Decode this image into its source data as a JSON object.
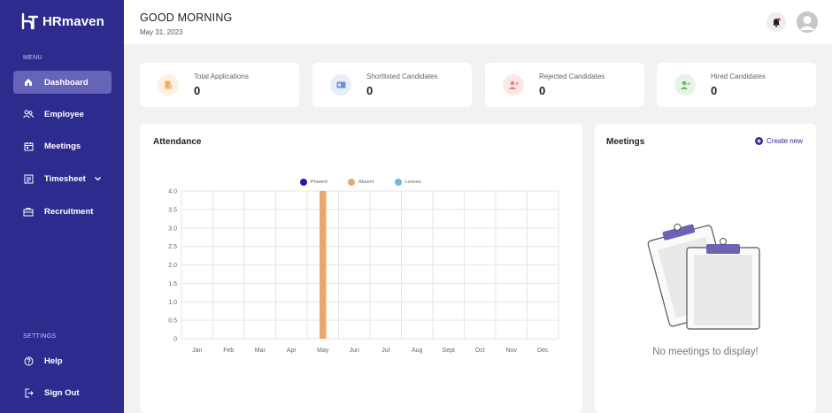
{
  "app": {
    "name": "HRmaven",
    "brand_color": "#2e2b8f"
  },
  "sidebar": {
    "menu_label": "MENU",
    "settings_label": "SETTINGS",
    "items": [
      {
        "label": "Dashboard",
        "icon": "home-icon",
        "active": true
      },
      {
        "label": "Employee",
        "icon": "users-icon"
      },
      {
        "label": "Meetings",
        "icon": "calendar-icon"
      },
      {
        "label": "Timesheet",
        "icon": "timesheet-icon",
        "has_dropdown": true
      },
      {
        "label": "Recruitment",
        "icon": "briefcase-icon"
      }
    ],
    "settings_items": [
      {
        "label": "Help",
        "icon": "help-icon"
      },
      {
        "label": "Sign Out",
        "icon": "sign-out-icon"
      }
    ]
  },
  "header": {
    "greeting": "GOOD MORNING",
    "date": "May 31, 2023"
  },
  "stats": [
    {
      "label": "Total Applications",
      "value": "0",
      "icon": "document-icon",
      "color": "#f5ad5c",
      "bg": "#fdf1e3"
    },
    {
      "label": "Shortlisted Candidates",
      "value": "0",
      "icon": "card-icon",
      "color": "#6b8fd6",
      "bg": "#e7edf9"
    },
    {
      "label": "Rejected Candidates",
      "value": "0",
      "icon": "user-reject-icon",
      "color": "#e58585",
      "bg": "#fbe7e7"
    },
    {
      "label": "Hired Candidates",
      "value": "0",
      "icon": "user-check-icon",
      "color": "#66bb6a",
      "bg": "#e6f4e6"
    }
  ],
  "attendance": {
    "title": "Attendance",
    "chart_data": {
      "type": "bar",
      "categories": [
        "Jan",
        "Feb",
        "Mar",
        "Apr",
        "May",
        "Jun",
        "Jul",
        "Aug",
        "Sept",
        "Oct",
        "Nov",
        "Dec"
      ],
      "series": [
        {
          "name": "Present",
          "color": "#2a1ca6",
          "values": [
            0,
            0,
            0,
            0,
            0,
            0,
            0,
            0,
            0,
            0,
            0,
            0
          ]
        },
        {
          "name": "Absent",
          "color": "#e9a86b",
          "values": [
            0,
            0,
            0,
            0,
            4,
            0,
            0,
            0,
            0,
            0,
            0,
            0
          ]
        },
        {
          "name": "Leaves",
          "color": "#6fb8e2",
          "values": [
            0,
            0,
            0,
            0,
            0,
            0,
            0,
            0,
            0,
            0,
            0,
            0
          ]
        }
      ],
      "y_ticks": [
        "4.0",
        "3.5",
        "3.0",
        "2.5",
        "2.0",
        "1.5",
        "1.0",
        "0.5",
        "0"
      ],
      "ylim": [
        0,
        4
      ],
      "grid": true,
      "legend_position": "top-center"
    }
  },
  "meetings": {
    "title": "Meetings",
    "create_label": "Create new",
    "empty_message": "No meetings to display!"
  }
}
